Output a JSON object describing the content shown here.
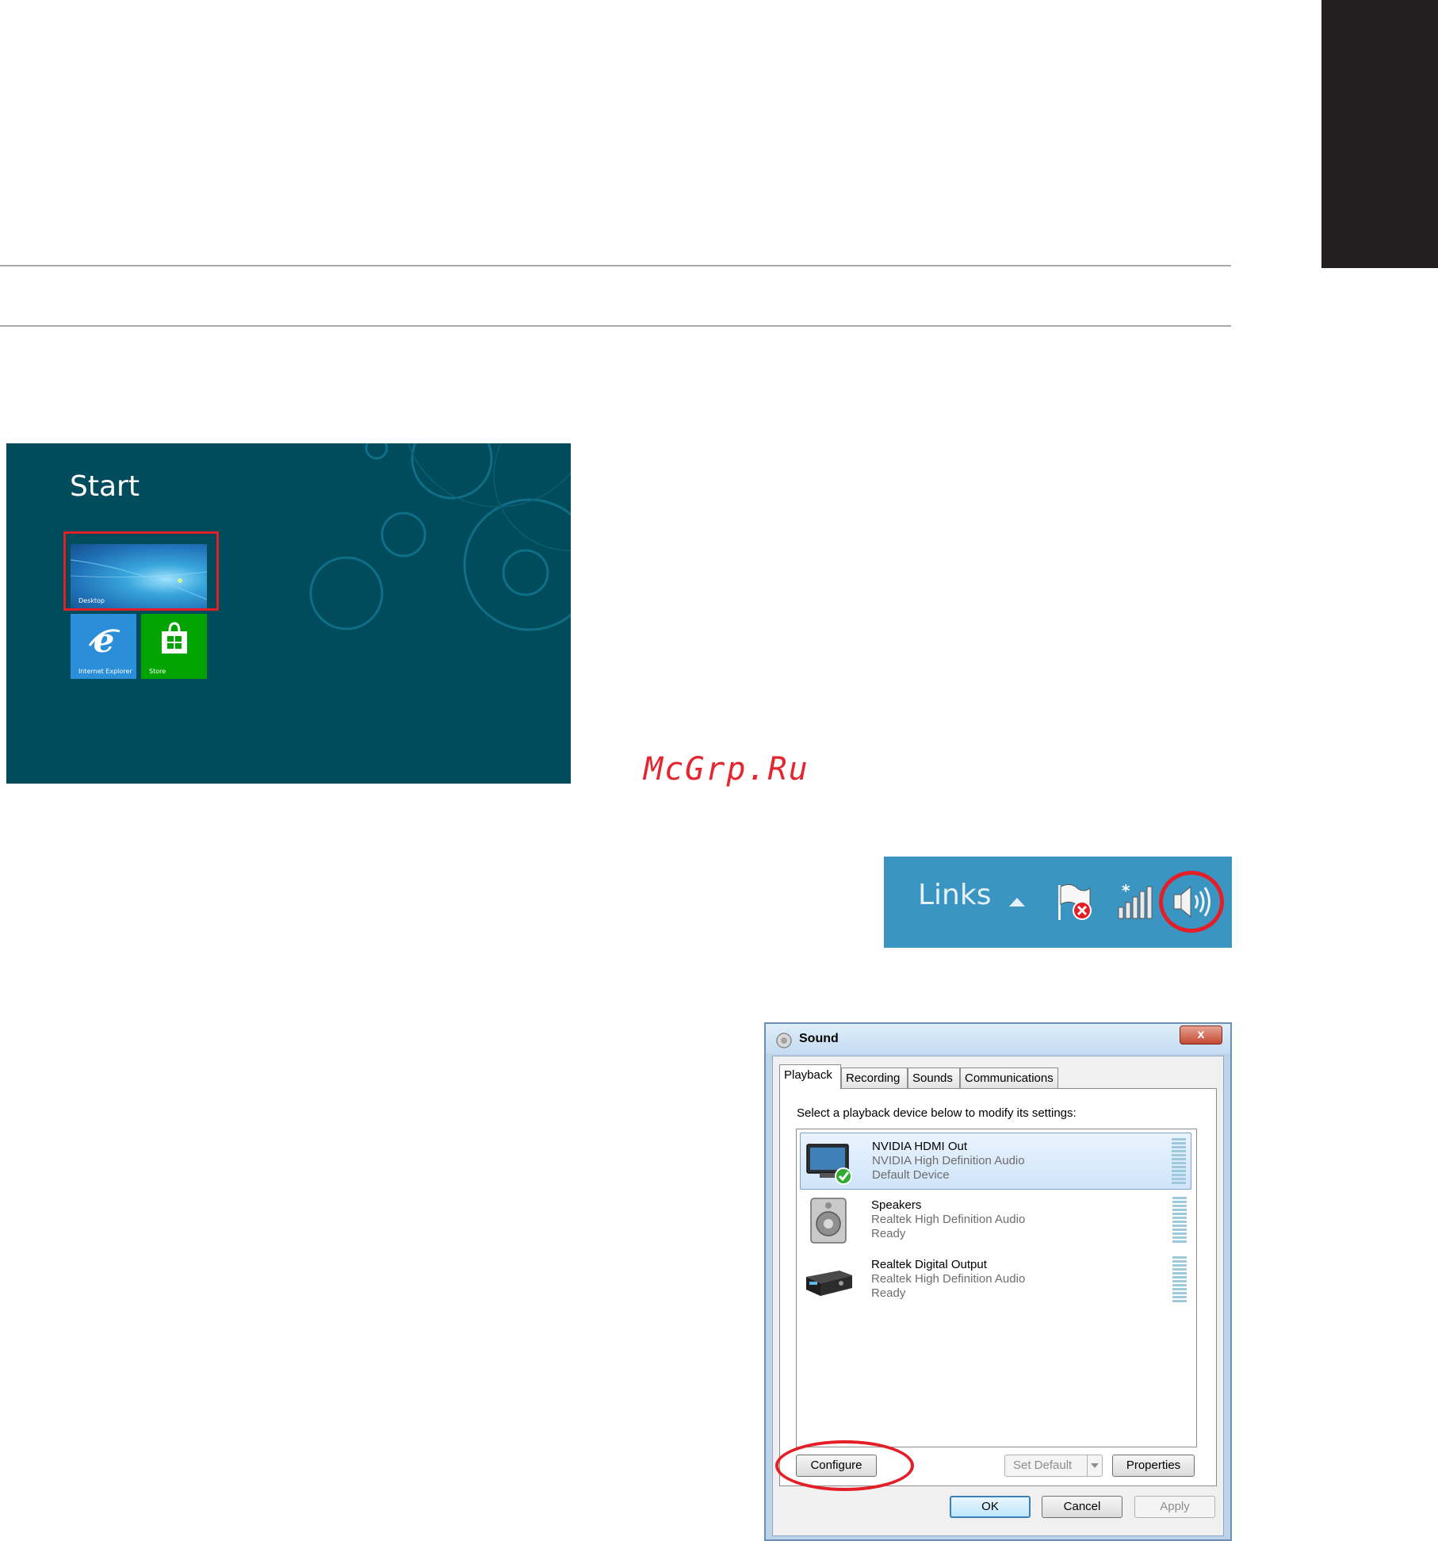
{
  "start_screen": {
    "title": "Start",
    "tiles": [
      {
        "label": "Desktop"
      },
      {
        "label": "Internet Explorer"
      },
      {
        "label": "Store"
      }
    ],
    "colors": {
      "background": "#004b5c",
      "highlight": "#e41e26"
    }
  },
  "watermark": "McGrp.Ru",
  "taskbar": {
    "links_label": "Links",
    "icons": [
      "chevron-up-icon",
      "action-center-flag-icon",
      "network-signal-icon",
      "speaker-volume-icon"
    ]
  },
  "sound_dialog": {
    "title": "Sound",
    "close_label": "x",
    "tabs": [
      {
        "label": "Playback"
      },
      {
        "label": "Recording"
      },
      {
        "label": "Sounds"
      },
      {
        "label": "Communications"
      }
    ],
    "instruction": "Select a playback device below to modify its settings:",
    "devices": [
      {
        "name": "NVIDIA HDMI Out",
        "driver": "NVIDIA High Definition Audio",
        "status": "Default Device",
        "selected": true,
        "icon": "monitor-icon"
      },
      {
        "name": "Speakers",
        "driver": "Realtek High Definition Audio",
        "status": "Ready",
        "selected": false,
        "icon": "speaker-icon"
      },
      {
        "name": "Realtek Digital Output",
        "driver": "Realtek High Definition Audio",
        "status": "Ready",
        "selected": false,
        "icon": "receiver-icon"
      }
    ],
    "buttons": {
      "configure": "Configure",
      "set_default": "Set Default",
      "properties": "Properties",
      "ok": "OK",
      "cancel": "Cancel",
      "apply": "Apply"
    }
  }
}
